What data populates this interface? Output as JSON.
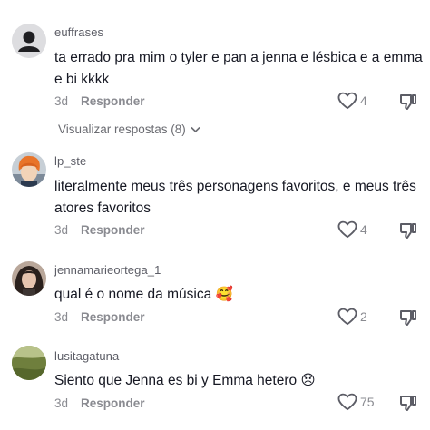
{
  "comments": [
    {
      "username": "euffrases",
      "text": "ta errado pra mim o tyler e pan a jenna e lésbica e a emma e bi kkkk",
      "time": "3d",
      "reply_label": "Responder",
      "likes": "4",
      "avatar_icon": "default-user-avatar"
    },
    {
      "username": "lp_ste",
      "text": "literalmente meus três personagens favoritos, e meus três atores favoritos",
      "time": "3d",
      "reply_label": "Responder",
      "likes": "4",
      "avatar_icon": "anime-character-avatar"
    },
    {
      "username": "jennamarieortega_1",
      "text": "qual é o nome da música 🥰",
      "time": "3d",
      "reply_label": "Responder",
      "likes": "2",
      "avatar_icon": "person-photo-avatar"
    },
    {
      "username": "lusitagatuna",
      "text": "Siento que Jenna es bi y Emma hetero 😞",
      "time": "3d",
      "reply_label": "Responder",
      "likes": "75",
      "avatar_icon": "landscape-photo-avatar"
    }
  ],
  "view_replies_label": "Visualizar respostas (8)",
  "colors": {
    "primary_text": "#161823",
    "secondary_text": "#8a8b91",
    "username_text": "#5c5d66"
  }
}
